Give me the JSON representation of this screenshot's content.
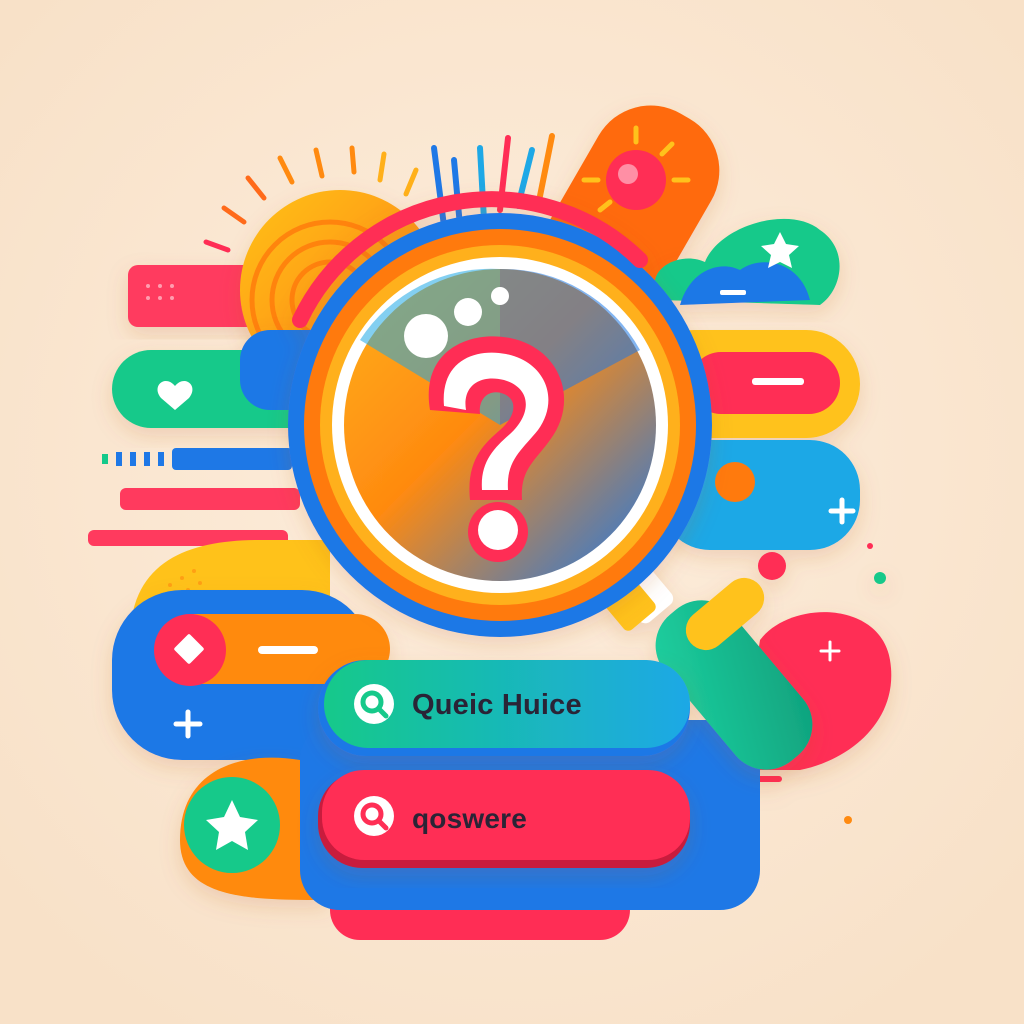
{
  "colors": {
    "background": "#fbe7cf",
    "blue": "#1e78e6",
    "red": "#f2264e",
    "orange": "#ff8a10",
    "yellow": "#ffc21a",
    "green": "#14c98a",
    "white": "#ffffff",
    "text": "#2a2436"
  },
  "icons": {
    "center": "question-mark-icon",
    "lens": "magnifying-glass-icon",
    "search_field": "search-icon"
  },
  "search_fields": [
    {
      "label": "Queic Huice",
      "accent": "#14c98a"
    },
    {
      "label": "qoswere",
      "accent": "#f2264e"
    }
  ]
}
